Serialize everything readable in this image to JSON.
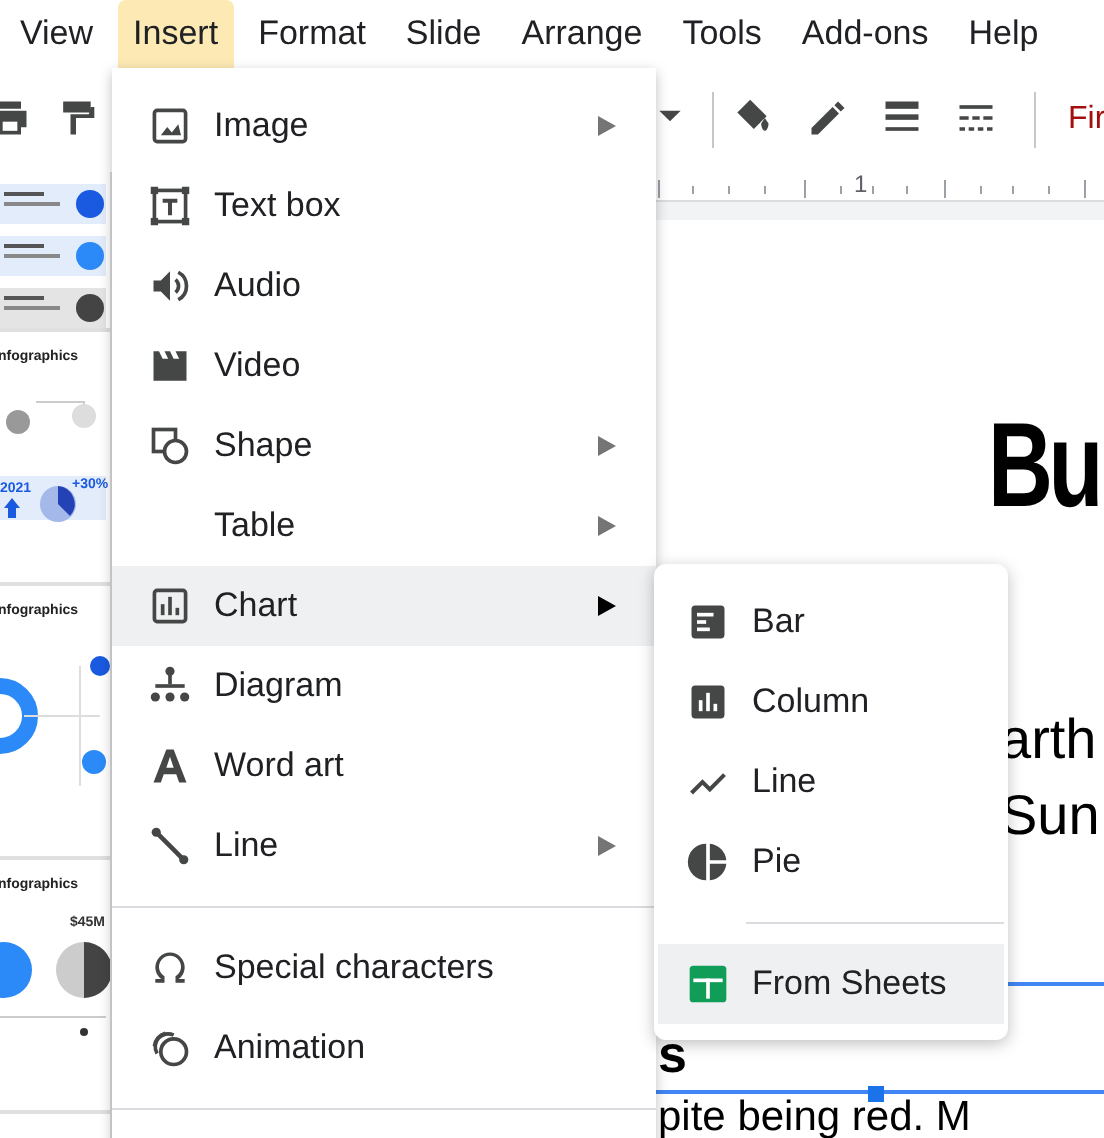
{
  "menu_bar": {
    "items": [
      {
        "label": "View",
        "selected": false
      },
      {
        "label": "Insert",
        "selected": true
      },
      {
        "label": "Format",
        "selected": false
      },
      {
        "label": "Slide",
        "selected": false
      },
      {
        "label": "Arrange",
        "selected": false
      },
      {
        "label": "Tools",
        "selected": false
      },
      {
        "label": "Add-ons",
        "selected": false
      },
      {
        "label": "Help",
        "selected": false
      }
    ]
  },
  "toolbar": {
    "font_name": "Fir"
  },
  "ruler": {
    "label": "1"
  },
  "filmstrip": {
    "thumbnails": [
      {
        "kind": "list"
      },
      {
        "kind": "timeline",
        "title": "nfographics",
        "values": [
          "2021",
          "+30%"
        ]
      },
      {
        "kind": "flow",
        "title": "nfographics"
      },
      {
        "kind": "pie",
        "title": "nfographics",
        "values": [
          "$45M"
        ]
      }
    ]
  },
  "slide": {
    "title": "Bu",
    "body_lines": [
      "arth",
      "Sun"
    ],
    "heading": "s",
    "paragraph": "pite being red. M"
  },
  "insert_menu": {
    "items": [
      {
        "kind": "item",
        "label": "Image",
        "has_submenu": true,
        "selected": false
      },
      {
        "kind": "item",
        "label": "Text box",
        "has_submenu": false,
        "selected": false
      },
      {
        "kind": "item",
        "label": "Audio",
        "has_submenu": false,
        "selected": false
      },
      {
        "kind": "item",
        "label": "Video",
        "has_submenu": false,
        "selected": false
      },
      {
        "kind": "item",
        "label": "Shape",
        "has_submenu": true,
        "selected": false
      },
      {
        "kind": "item",
        "label": "Table",
        "has_submenu": true,
        "selected": false
      },
      {
        "kind": "item",
        "label": "Chart",
        "has_submenu": true,
        "selected": true
      },
      {
        "kind": "item",
        "label": "Diagram",
        "has_submenu": false,
        "selected": false
      },
      {
        "kind": "item",
        "label": "Word art",
        "has_submenu": false,
        "selected": false
      },
      {
        "kind": "item",
        "label": "Line",
        "has_submenu": true,
        "selected": false
      },
      {
        "kind": "separator"
      },
      {
        "kind": "item",
        "label": "Special characters",
        "has_submenu": false,
        "selected": false
      },
      {
        "kind": "item",
        "label": "Animation",
        "has_submenu": false,
        "selected": false
      },
      {
        "kind": "separator"
      }
    ]
  },
  "chart_submenu": {
    "items": [
      {
        "kind": "item",
        "label": "Bar",
        "selected": false
      },
      {
        "kind": "item",
        "label": "Column",
        "selected": false
      },
      {
        "kind": "item",
        "label": "Line",
        "selected": false
      },
      {
        "kind": "item",
        "label": "Pie",
        "selected": false
      },
      {
        "kind": "separator"
      },
      {
        "kind": "item",
        "label": "From Sheets",
        "selected": true
      }
    ]
  }
}
